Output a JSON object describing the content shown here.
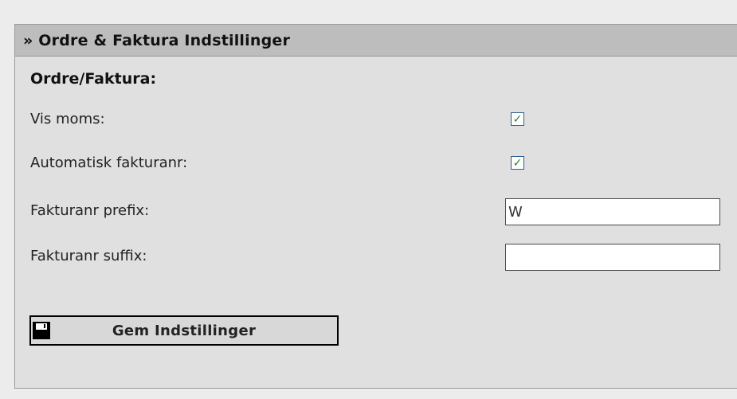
{
  "panel": {
    "title": "» Ordre & Faktura Indstillinger"
  },
  "section": {
    "title": "Ordre/Faktura:"
  },
  "fields": [
    {
      "label": "Vis moms:",
      "type": "checkbox",
      "checked": true
    },
    {
      "label": "Automatisk fakturanr:",
      "type": "checkbox",
      "checked": true
    },
    {
      "label": "Fakturanr prefix:",
      "type": "text",
      "value": "W",
      "placeholder": ""
    },
    {
      "label": "Fakturanr suffix:",
      "type": "text",
      "value": "",
      "placeholder": ""
    }
  ],
  "save_button": {
    "label": "Gem Indstillinger",
    "icon": "floppy-disk-icon"
  },
  "colors": {
    "panel_header_bg": "#bdbdbd",
    "panel_bg": "#e0e0e0",
    "check_color": "#1c8b2a"
  }
}
